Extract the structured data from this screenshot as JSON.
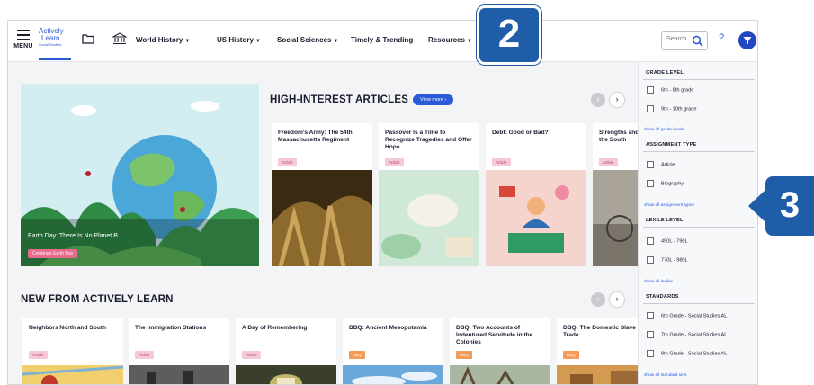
{
  "nav": {
    "menu_label": "MENU",
    "logo": {
      "line1": "Actively",
      "line2": "Learn",
      "line3": "Social Studies"
    },
    "items": [
      {
        "label": "World History",
        "dropdown": true
      },
      {
        "label": "US History",
        "dropdown": true
      },
      {
        "label": "Social Sciences",
        "dropdown": true
      },
      {
        "label": "Timely & Trending",
        "dropdown": false
      },
      {
        "label": "Resources",
        "dropdown": true
      }
    ],
    "search_placeholder": "Search",
    "help": "?"
  },
  "callouts": {
    "top": "2",
    "side": "3"
  },
  "hero": {
    "caption": "Earth Day: There Is No Planet B",
    "tag": "Celebrate Earth Day"
  },
  "high_interest": {
    "title": "HIGH-INTEREST ARTICLES",
    "view_more": "View more",
    "cards": [
      {
        "title": "Freedom's Army: The 54th Massachusetts Regiment",
        "badge": "Article"
      },
      {
        "title": "Passover Is a Time to Recognize Tragedies and Offer Hope",
        "badge": "Article"
      },
      {
        "title": "Debt: Good or Bad?",
        "badge": "Article"
      },
      {
        "title": "Strengths and Weaknesses of the South",
        "badge": "Article"
      }
    ]
  },
  "new_from": {
    "title": "NEW FROM ACTIVELY LEARN",
    "cards": [
      {
        "title": "Neighbors North and South",
        "badge": "Article"
      },
      {
        "title": "The Immigration Stations",
        "badge": "Article"
      },
      {
        "title": "A Day of Remembering",
        "badge": "Article"
      },
      {
        "title": "DBQ: Ancient Mesopotamia",
        "badge": "DBQ"
      },
      {
        "title": "DBQ: Two Accounts of Indentured Servitude in the Colonies",
        "badge": "DBQ"
      },
      {
        "title": "DBQ: The Domestic Slave Trade",
        "badge": "DBQ"
      }
    ]
  },
  "filters": {
    "grade": {
      "title": "GRADE LEVEL",
      "options": [
        "6th - 8th grade",
        "9th - 10th grade"
      ],
      "link": "show all grade levels"
    },
    "assignment": {
      "title": "ASSIGNMENT TYPE",
      "options": [
        "Article",
        "Biography"
      ],
      "link": "show all assignment types"
    },
    "lexile": {
      "title": "LEXILE LEVEL",
      "options": [
        "450L - 790L",
        "770L - 980L"
      ],
      "link": "show all lexiles"
    },
    "standards": {
      "title": "STANDARDS",
      "options": [
        "6th Grade - Social Studies AL",
        "7th Grade - Social Studies AL",
        "8th Grade - Social Studies AL"
      ],
      "link": "show all standard sets"
    }
  },
  "colors": {
    "accent": "#2a5bd7",
    "callout": "#1f5da8",
    "dbq": "#f49b58",
    "article_badge": "#f5c9d8"
  }
}
